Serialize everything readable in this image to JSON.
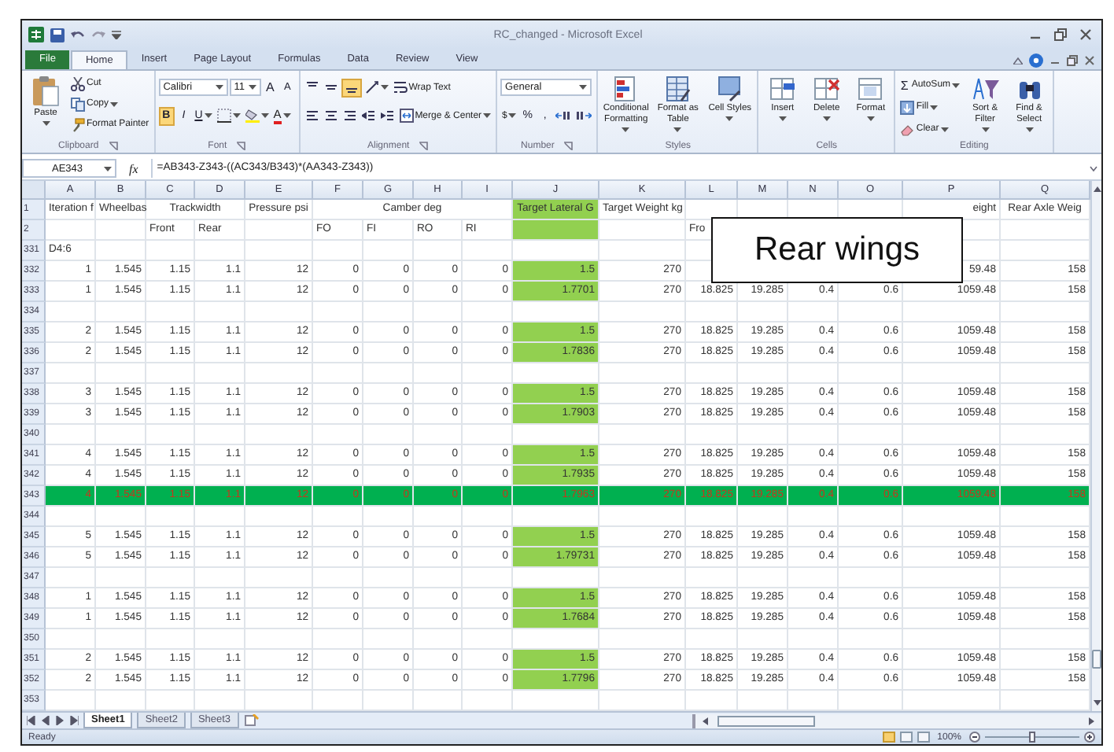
{
  "window": {
    "title": "RC_changed - Microsoft Excel"
  },
  "ribbon_tabs": [
    {
      "label": "File",
      "kind": "file",
      "selected": false
    },
    {
      "label": "Home",
      "kind": "tab",
      "selected": true
    },
    {
      "label": "Insert",
      "kind": "tab",
      "selected": false
    },
    {
      "label": "Page Layout",
      "kind": "tab",
      "selected": false
    },
    {
      "label": "Formulas",
      "kind": "tab",
      "selected": false
    },
    {
      "label": "Data",
      "kind": "tab",
      "selected": false
    },
    {
      "label": "Review",
      "kind": "tab",
      "selected": false
    },
    {
      "label": "View",
      "kind": "tab",
      "selected": false
    }
  ],
  "ribbon": {
    "clipboard": {
      "label": "Clipboard",
      "paste": "Paste",
      "cut": "Cut",
      "copy": "Copy",
      "format_painter": "Format Painter"
    },
    "font": {
      "label": "Font",
      "name": "Calibri",
      "size": "11",
      "grow": "A",
      "shrink": "A",
      "bold": {
        "label": "B",
        "selected": true
      },
      "italic": {
        "label": "I",
        "selected": false
      },
      "underline": {
        "label": "U",
        "selected": false
      },
      "font_color": "A"
    },
    "alignment": {
      "label": "Alignment",
      "vertical": [
        {
          "selected": false
        },
        {
          "selected": false
        },
        {
          "selected": true
        }
      ],
      "wrap_text": "Wrap Text",
      "merge": "Merge & Center"
    },
    "number": {
      "label": "Number",
      "format": "General",
      "currency": "$",
      "percent": "%",
      "comma": ","
    },
    "styles": {
      "label": "Styles",
      "buttons": [
        "Conditional Formatting",
        "Format as Table",
        "Cell Styles"
      ]
    },
    "cells": {
      "label": "Cells",
      "buttons": [
        "Insert",
        "Delete",
        "Format"
      ]
    },
    "editing": {
      "label": "Editing",
      "small": [
        {
          "glyph": "Σ",
          "label": "AutoSum"
        },
        {
          "label": "Fill"
        },
        {
          "label": "Clear"
        }
      ],
      "large": [
        "Sort & Filter",
        "Find & Select"
      ]
    }
  },
  "formula_bar": {
    "name_box": "AE343",
    "function_label": "fx",
    "formula": "=AB343-Z343-((AC343/B343)*(AA343-Z343))"
  },
  "columns": [
    {
      "letter": "A",
      "highlighted": false
    },
    {
      "letter": "B",
      "highlighted": false
    },
    {
      "letter": "C",
      "highlighted": false
    },
    {
      "letter": "D",
      "highlighted": false
    },
    {
      "letter": "E",
      "highlighted": false
    },
    {
      "letter": "F",
      "highlighted": false
    },
    {
      "letter": "G",
      "highlighted": false
    },
    {
      "letter": "H",
      "highlighted": false
    },
    {
      "letter": "I",
      "highlighted": false
    },
    {
      "letter": "J",
      "highlighted": true
    },
    {
      "letter": "K",
      "highlighted": false
    },
    {
      "letter": "L",
      "highlighted": false
    },
    {
      "letter": "M",
      "highlighted": false
    },
    {
      "letter": "N",
      "highlighted": false
    },
    {
      "letter": "O",
      "highlighted": false
    },
    {
      "letter": "P",
      "highlighted": false
    },
    {
      "letter": "Q",
      "highlighted": false
    }
  ],
  "rows": [
    {
      "number": "1",
      "kind": "header",
      "highlighted": false,
      "cells": [
        "Iteration f",
        "Wheelbas",
        "Trackwidth",
        "Pressure psi",
        "Camber deg",
        "Target Lateral G",
        "Target Weight kg",
        "eight",
        "Rear Axle Weig"
      ]
    },
    {
      "number": "2",
      "kind": "header",
      "highlighted": false,
      "cells": [
        "Front",
        "Rear",
        "FO",
        "FI",
        "RO",
        "RI",
        "Fro"
      ]
    },
    {
      "number": "331",
      "kind": "note",
      "highlighted": false,
      "cells": [
        "D4:6"
      ]
    },
    {
      "number": "332",
      "kind": "data",
      "highlighted": false,
      "cells": [
        "1",
        "1.545",
        "1.15",
        "1.1",
        "12",
        "0",
        "0",
        "0",
        "0",
        "1.5",
        "270",
        "59.48",
        "158"
      ]
    },
    {
      "number": "333",
      "kind": "data",
      "highlighted": false,
      "cells": [
        "1",
        "1.545",
        "1.15",
        "1.1",
        "12",
        "0",
        "0",
        "0",
        "0",
        "1.7701",
        "270",
        "18.825",
        "19.285",
        "0.4",
        "0.6",
        "1059.48",
        "158"
      ]
    },
    {
      "number": "334",
      "kind": "blank",
      "highlighted": false
    },
    {
      "number": "335",
      "kind": "data",
      "highlighted": false,
      "cells": [
        "2",
        "1.545",
        "1.15",
        "1.1",
        "12",
        "0",
        "0",
        "0",
        "0",
        "1.5",
        "270",
        "18.825",
        "19.285",
        "0.4",
        "0.6",
        "1059.48",
        "158"
      ]
    },
    {
      "number": "336",
      "kind": "data",
      "highlighted": false,
      "cells": [
        "2",
        "1.545",
        "1.15",
        "1.1",
        "12",
        "0",
        "0",
        "0",
        "0",
        "1.7836",
        "270",
        "18.825",
        "19.285",
        "0.4",
        "0.6",
        "1059.48",
        "158"
      ]
    },
    {
      "number": "337",
      "kind": "blank",
      "highlighted": false
    },
    {
      "number": "338",
      "kind": "data",
      "highlighted": false,
      "cells": [
        "3",
        "1.545",
        "1.15",
        "1.1",
        "12",
        "0",
        "0",
        "0",
        "0",
        "1.5",
        "270",
        "18.825",
        "19.285",
        "0.4",
        "0.6",
        "1059.48",
        "158"
      ]
    },
    {
      "number": "339",
      "kind": "data",
      "highlighted": false,
      "cells": [
        "3",
        "1.545",
        "1.15",
        "1.1",
        "12",
        "0",
        "0",
        "0",
        "0",
        "1.7903",
        "270",
        "18.825",
        "19.285",
        "0.4",
        "0.6",
        "1059.48",
        "158"
      ]
    },
    {
      "number": "340",
      "kind": "blank",
      "highlighted": false
    },
    {
      "number": "341",
      "kind": "data",
      "highlighted": false,
      "cells": [
        "4",
        "1.545",
        "1.15",
        "1.1",
        "12",
        "0",
        "0",
        "0",
        "0",
        "1.5",
        "270",
        "18.825",
        "19.285",
        "0.4",
        "0.6",
        "1059.48",
        "158"
      ]
    },
    {
      "number": "342",
      "kind": "data",
      "highlighted": false,
      "cells": [
        "4",
        "1.545",
        "1.15",
        "1.1",
        "12",
        "0",
        "0",
        "0",
        "0",
        "1.7935",
        "270",
        "18.825",
        "19.285",
        "0.4",
        "0.6",
        "1059.48",
        "158"
      ]
    },
    {
      "number": "343",
      "kind": "data",
      "highlighted": true,
      "cells": [
        "4",
        "1.545",
        "1.15",
        "1.1",
        "12",
        "0",
        "0",
        "0",
        "0",
        "1.7963",
        "270",
        "18.825",
        "19.285",
        "0.4",
        "0.6",
        "1059.48",
        "158"
      ]
    },
    {
      "number": "344",
      "kind": "blank",
      "highlighted": false
    },
    {
      "number": "345",
      "kind": "data",
      "highlighted": false,
      "cells": [
        "5",
        "1.545",
        "1.15",
        "1.1",
        "12",
        "0",
        "0",
        "0",
        "0",
        "1.5",
        "270",
        "18.825",
        "19.285",
        "0.4",
        "0.6",
        "1059.48",
        "158"
      ]
    },
    {
      "number": "346",
      "kind": "data",
      "highlighted": false,
      "cells": [
        "5",
        "1.545",
        "1.15",
        "1.1",
        "12",
        "0",
        "0",
        "0",
        "0",
        "1.79731",
        "270",
        "18.825",
        "19.285",
        "0.4",
        "0.6",
        "1059.48",
        "158"
      ]
    },
    {
      "number": "347",
      "kind": "blank",
      "highlighted": false
    },
    {
      "number": "348",
      "kind": "data",
      "highlighted": false,
      "cells": [
        "1",
        "1.545",
        "1.15",
        "1.1",
        "12",
        "0",
        "0",
        "0",
        "0",
        "1.5",
        "270",
        "18.825",
        "19.285",
        "0.4",
        "0.6",
        "1059.48",
        "158"
      ]
    },
    {
      "number": "349",
      "kind": "data",
      "highlighted": false,
      "cells": [
        "1",
        "1.545",
        "1.15",
        "1.1",
        "12",
        "0",
        "0",
        "0",
        "0",
        "1.7684",
        "270",
        "18.825",
        "19.285",
        "0.4",
        "0.6",
        "1059.48",
        "158"
      ]
    },
    {
      "number": "350",
      "kind": "blank",
      "highlighted": false
    },
    {
      "number": "351",
      "kind": "data",
      "highlighted": false,
      "cells": [
        "2",
        "1.545",
        "1.15",
        "1.1",
        "12",
        "0",
        "0",
        "0",
        "0",
        "1.5",
        "270",
        "18.825",
        "19.285",
        "0.4",
        "0.6",
        "1059.48",
        "158"
      ]
    },
    {
      "number": "352",
      "kind": "data",
      "highlighted": false,
      "cells": [
        "2",
        "1.545",
        "1.15",
        "1.1",
        "12",
        "0",
        "0",
        "0",
        "0",
        "1.7796",
        "270",
        "18.825",
        "19.285",
        "0.4",
        "0.6",
        "1059.48",
        "158"
      ]
    },
    {
      "number": "353",
      "kind": "blank",
      "highlighted": false
    }
  ],
  "callout": {
    "text": "Rear wings"
  },
  "sheet_tabs": [
    {
      "label": "Sheet1",
      "selected": true
    },
    {
      "label": "Sheet2",
      "selected": false
    },
    {
      "label": "Sheet3",
      "selected": false
    }
  ],
  "status_bar": {
    "text": "Ready",
    "views": [
      {
        "selected": true
      },
      {
        "selected": false
      },
      {
        "selected": false
      }
    ],
    "zoom": "100%",
    "zoom_slider": {
      "level": 0.5
    }
  }
}
